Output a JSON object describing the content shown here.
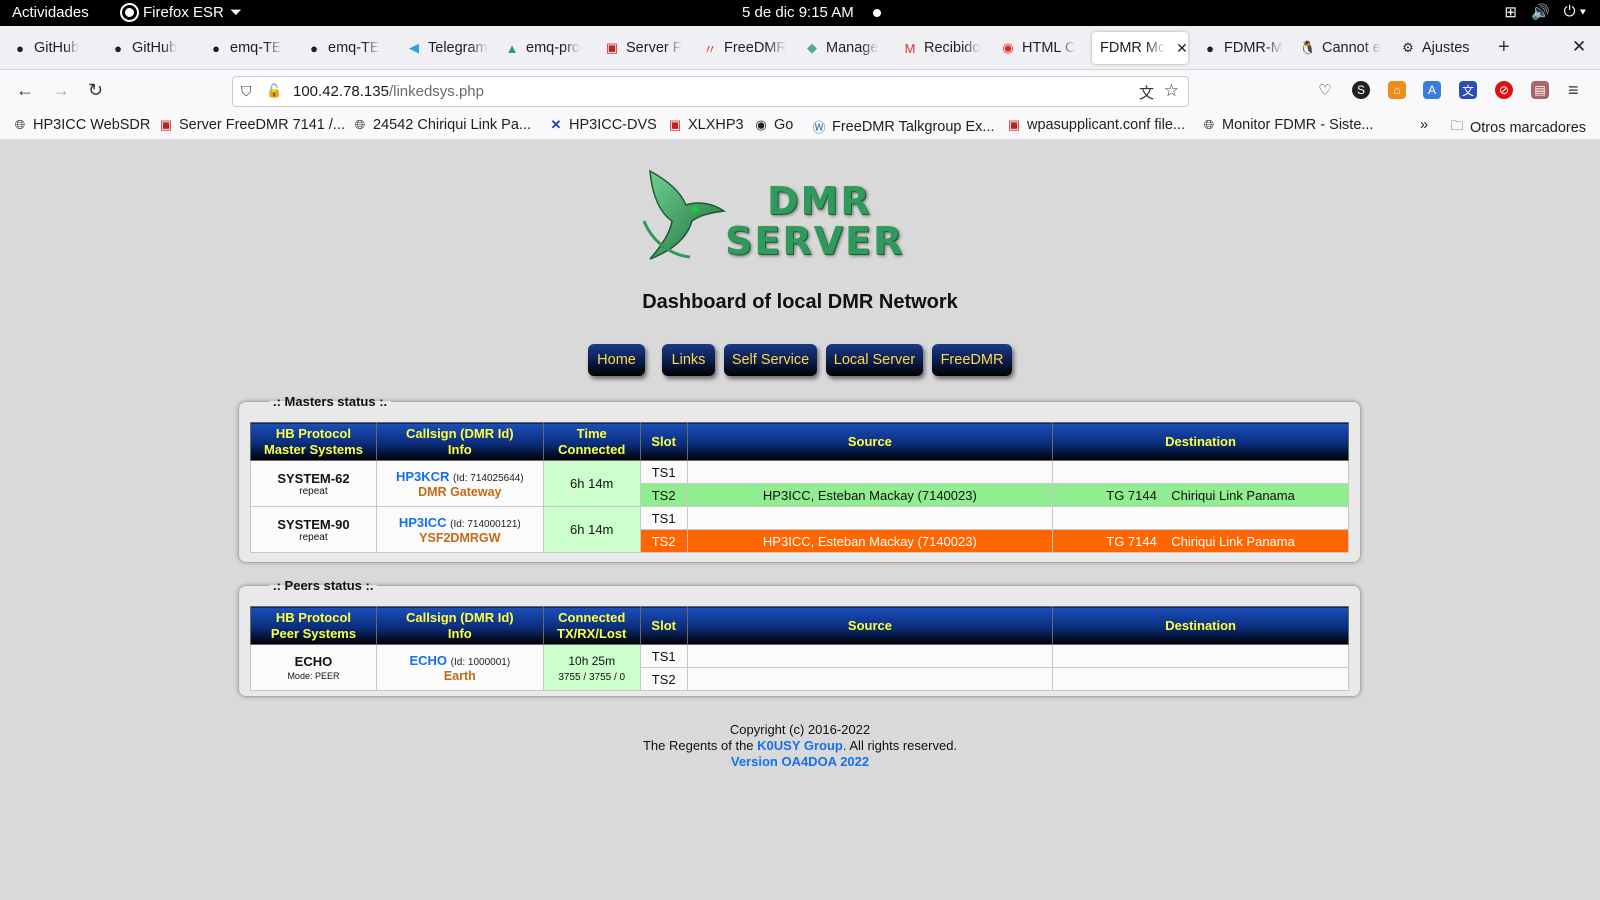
{
  "topbar": {
    "activities": "Actividades",
    "app_name": "Firefox ESR",
    "clock": "5 de dic  9:15 AM"
  },
  "tabs": [
    {
      "label": "GitHub",
      "icon": "github-icon"
    },
    {
      "label": "GitHub",
      "icon": "github-icon"
    },
    {
      "label": "emq-TE",
      "icon": "github-icon"
    },
    {
      "label": "emq-TE",
      "icon": "github-icon"
    },
    {
      "label": "Telegram",
      "icon": "telegram-icon"
    },
    {
      "label": "emq-pro",
      "icon": "drive-icon"
    },
    {
      "label": "Server F",
      "icon": "flag-icon"
    },
    {
      "label": "FreeDMR",
      "icon": "freedmr-icon"
    },
    {
      "label": "Manage",
      "icon": "manage-icon"
    },
    {
      "label": "Recibido",
      "icon": "gmail-icon"
    },
    {
      "label": "HTML C",
      "icon": "opera-icon"
    },
    {
      "label": "FDMR Mo",
      "icon": "none",
      "active": true
    },
    {
      "label": "FDMR-M",
      "icon": "github-icon"
    },
    {
      "label": "Cannot e",
      "icon": "linux-icon"
    },
    {
      "label": "Ajustes",
      "icon": "gear-icon"
    }
  ],
  "url": {
    "host": "100.42.78.135",
    "path": "/linkedsys.php"
  },
  "bookmarks": [
    {
      "label": "HP3ICC WebSDR",
      "icon": "globe-icon"
    },
    {
      "label": "Server FreeDMR 7141 /...",
      "icon": "flag-icon"
    },
    {
      "label": "24542 Chiriqui Link Pa...",
      "icon": "globe-icon"
    },
    {
      "label": "HP3ICC-DVS",
      "icon": "x-icon"
    },
    {
      "label": "XLXHP3",
      "icon": "flag-icon"
    },
    {
      "label": "Go",
      "icon": "circle-icon"
    },
    {
      "label": "FreeDMR Talkgroup Ex...",
      "icon": "wordpress-icon"
    },
    {
      "label": "wpasupplicant.conf file...",
      "icon": "flag-icon"
    },
    {
      "label": "Monitor FDMR - Siste...",
      "icon": "globe-icon"
    }
  ],
  "bookmarks_other": "Otros marcadores",
  "logo": {
    "line1": "DMR",
    "line2": "SERVER"
  },
  "page_title": "Dashboard of local DMR Network",
  "menu": [
    "Home",
    "Links",
    "Self Service",
    "Local Server",
    "FreeDMR"
  ],
  "masters": {
    "legend": ".: Masters status :.",
    "headers": [
      "HB Protocol\nMaster Systems",
      "Callsign (DMR Id)\nInfo",
      "Time\nConnected",
      "Slot",
      "Source",
      "Destination"
    ],
    "rows": [
      {
        "system": "SYSTEM-62",
        "mode": "repeat",
        "callsign": "HP3KCR",
        "dmr_id": "(Id: 714025644)",
        "info": "DMR Gateway",
        "time": "6h 14m",
        "slots": [
          {
            "slot": "TS1",
            "source": "",
            "destination": "",
            "state": "idle"
          },
          {
            "slot": "TS2",
            "source": "HP3ICC, Esteban Mackay (7140023)",
            "destination": "TG 7144    Chiriqui Link Panama",
            "state": "rx"
          }
        ]
      },
      {
        "system": "SYSTEM-90",
        "mode": "repeat",
        "callsign": "HP3ICC",
        "dmr_id": "(Id: 714000121)",
        "info": "YSF2DMRGW",
        "time": "6h 14m",
        "slots": [
          {
            "slot": "TS1",
            "source": "",
            "destination": "",
            "state": "idle"
          },
          {
            "slot": "TS2",
            "source": "HP3ICC, Esteban Mackay (7140023)",
            "destination": "TG 7144    Chiriqui Link Panama",
            "state": "tx"
          }
        ]
      }
    ]
  },
  "peers": {
    "legend": ".: Peers status :.",
    "headers": [
      "HB Protocol\nPeer Systems",
      "Callsign (DMR Id)\nInfo",
      "Connected\nTX/RX/Lost",
      "Slot",
      "Source",
      "Destination"
    ],
    "rows": [
      {
        "system": "ECHO",
        "mode": "Mode: PEER",
        "callsign": "ECHO",
        "dmr_id": "(Id: 1000001)",
        "info": "Earth",
        "connected": "10h 25m",
        "txrx": "3755 / 3755 / 0",
        "slots": [
          {
            "slot": "TS1",
            "source": "",
            "destination": ""
          },
          {
            "slot": "TS2",
            "source": "",
            "destination": ""
          }
        ]
      }
    ]
  },
  "footer": {
    "line1": "Copyright (c) 2016-2022",
    "line2_pre": "The Regents of the ",
    "line2_link": "K0USY Group",
    "line2_post": ". All rights reserved.",
    "version": "Version OA4DOA 2022"
  },
  "colors": {
    "slot_rx": "#90ee90",
    "slot_tx": "#ff6600",
    "header_text": "#ffff40",
    "menu_text": "#ffd84a",
    "link": "#1570ee"
  }
}
